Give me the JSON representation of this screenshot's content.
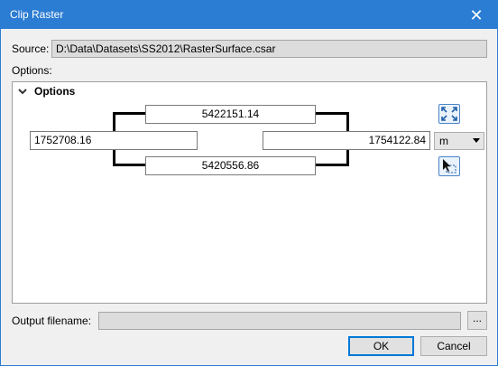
{
  "window": {
    "title": "Clip Raster",
    "close_glyph": "✕"
  },
  "source": {
    "label": "Source:",
    "value": "D:\\Data\\Datasets\\SS2012\\RasterSurface.csar"
  },
  "options_label": "Options:",
  "options_panel": {
    "title": "Options",
    "extent": {
      "north": "5422151.14",
      "south": "5420556.86",
      "west": "1752708.16",
      "east": "1754122.84"
    },
    "unit": {
      "selected": "m"
    },
    "icons": {
      "full_extent": "full-extent-icon",
      "select_area": "select-area-icon"
    }
  },
  "output": {
    "label": "Output filename:",
    "value": "",
    "browse_label": "..."
  },
  "buttons": {
    "ok": "OK",
    "cancel": "Cancel"
  },
  "colors": {
    "titlebar": "#2b7cd3",
    "accent": "#0078d7"
  }
}
